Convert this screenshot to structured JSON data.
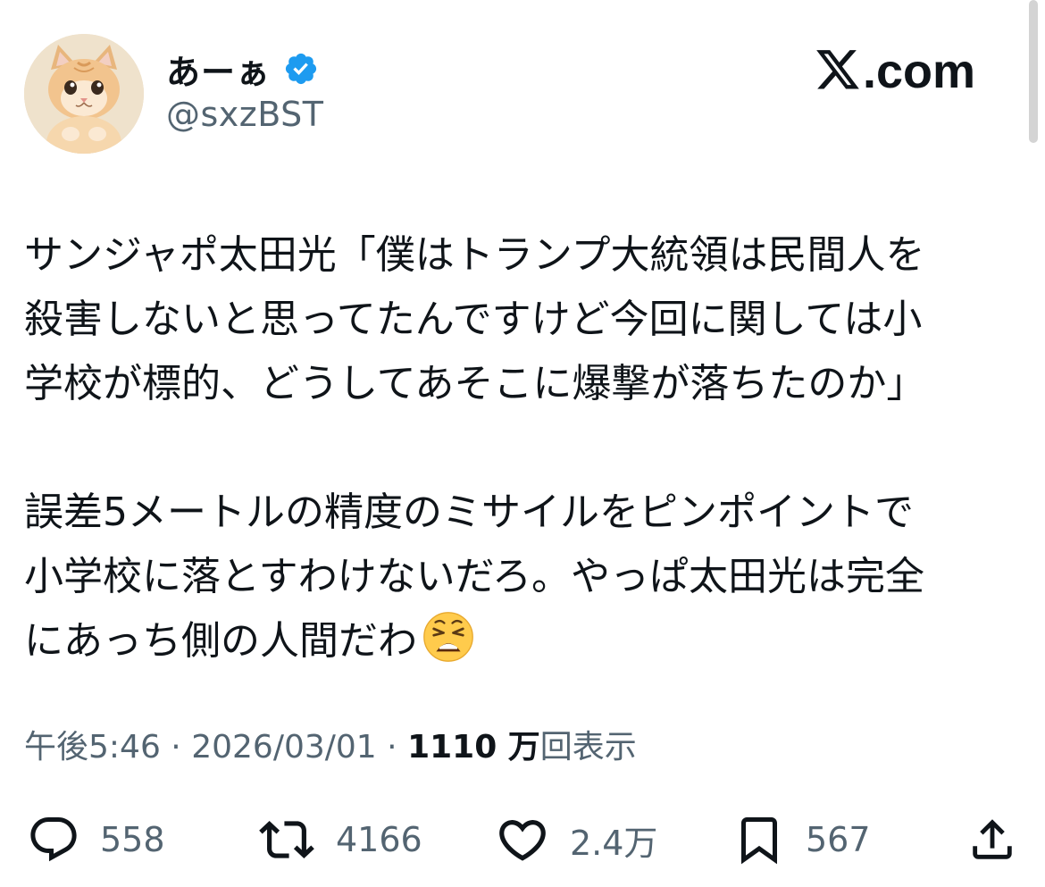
{
  "user": {
    "display_name": "あーぁ",
    "handle": "@sxzBST",
    "verified": true,
    "avatar_icon": "kitten-avatar-icon"
  },
  "brand": {
    "label": ".com",
    "icon": "x-logo-icon"
  },
  "tweet": {
    "lines": [
      "サンジャポ太田光「僕はトランプ大統領は民間人を",
      "殺害しないと思ってたんですけど今回に関しては小",
      "学校が標的、どうしてあそこに爆撃が落ちたのか」",
      "誤差5メートルの精度のミサイルをピンポイントで",
      "小学校に落とすわけないだろ。やっぱ太田光は完全",
      "にあっち側の人間だわ"
    ],
    "emoji": "weary-face-emoji"
  },
  "meta": {
    "time": "午後5:46",
    "separator": "·",
    "date": "2026/03/01",
    "views_count": "1110 万",
    "views_label": "回表示"
  },
  "actions": {
    "reply_count": "558",
    "retweet_count": "4166",
    "like_count": "2.4万",
    "bookmark_count": "567"
  },
  "colors": {
    "text": "#0f1419",
    "secondary": "#536471",
    "verified_blue": "#1d9bf0"
  }
}
